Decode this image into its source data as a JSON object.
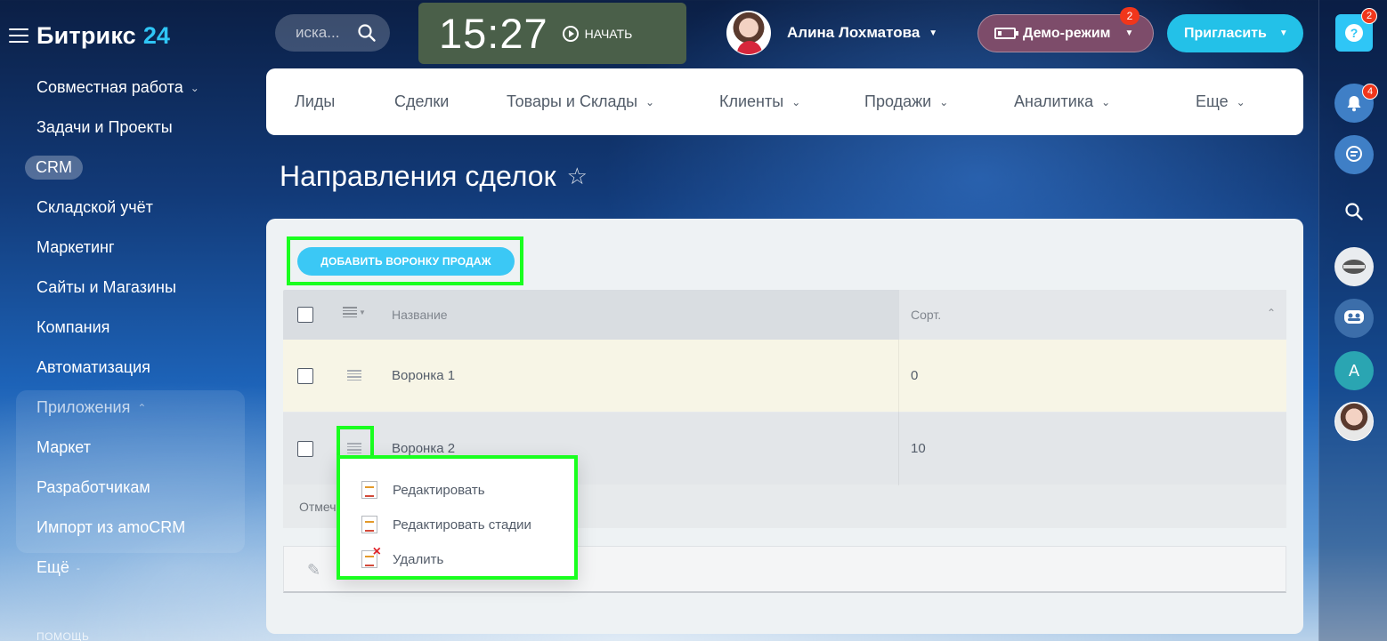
{
  "app": {
    "name": "Битрикс",
    "version": "24"
  },
  "search": {
    "placeholder": "иска..."
  },
  "clock": {
    "time": "15:27",
    "start_label": "НАЧАТЬ"
  },
  "user": {
    "name": "Алина Лохматова"
  },
  "demo": {
    "label": "Демо-режим",
    "badge": "2"
  },
  "invite": {
    "label": "Пригласить"
  },
  "sidebar": {
    "items": [
      {
        "label": "Совместная работа"
      },
      {
        "label": "Задачи и Проекты"
      },
      {
        "label": "CRM"
      },
      {
        "label": "Складской учёт"
      },
      {
        "label": "Маркетинг"
      },
      {
        "label": "Сайты и Магазины"
      },
      {
        "label": "Компания"
      },
      {
        "label": "Автоматизация"
      },
      {
        "label": "Приложения"
      },
      {
        "label": "Маркет"
      },
      {
        "label": "Разработчикам"
      },
      {
        "label": "Импорт из amoCRM"
      },
      {
        "label": "Ещё"
      }
    ],
    "help": "помощь"
  },
  "rail": {
    "help_badge": "2",
    "notify_badge": "4",
    "avatar_letter": "A"
  },
  "topnav": {
    "tabs": [
      {
        "label": "Лиды"
      },
      {
        "label": "Сделки"
      },
      {
        "label": "Товары и Склады"
      },
      {
        "label": "Клиенты"
      },
      {
        "label": "Продажи"
      },
      {
        "label": "Аналитика"
      },
      {
        "label": "Еще"
      }
    ]
  },
  "page": {
    "title": "Направления сделок"
  },
  "toolbar": {
    "add_label": "ДОБАВИТЬ ВОРОНКУ ПРОДАЖ"
  },
  "grid": {
    "columns": {
      "name": "Название",
      "sort": "Сорт."
    },
    "rows": [
      {
        "name": "Воронка 1",
        "sort": "0"
      },
      {
        "name": "Воронка 2",
        "sort": "10"
      }
    ],
    "footer": "Отмеч"
  },
  "context_menu": {
    "items": [
      {
        "label": "Редактировать"
      },
      {
        "label": "Редактировать стадии"
      },
      {
        "label": "Удалить"
      }
    ]
  }
}
